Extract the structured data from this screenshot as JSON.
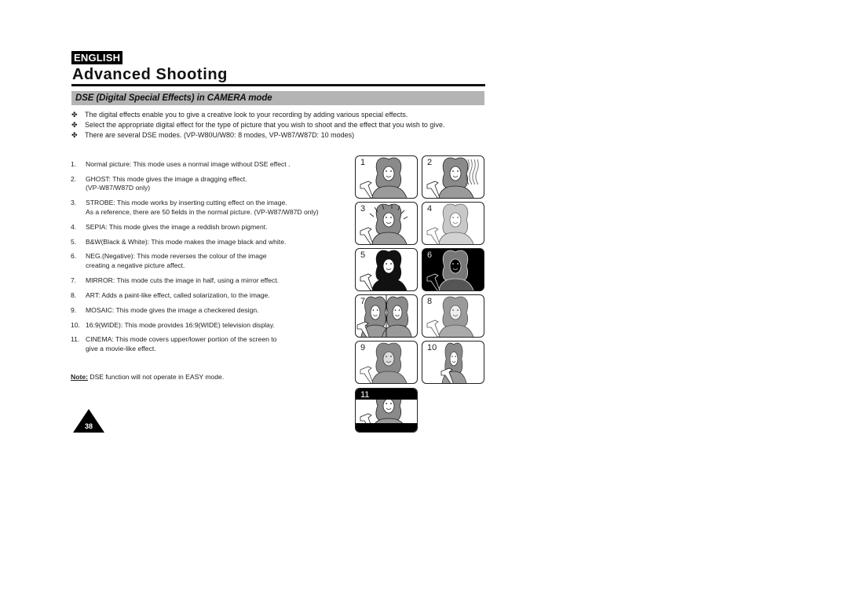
{
  "header": {
    "language": "ENGLISH",
    "title": "Advanced Shooting",
    "section_title": "DSE (Digital Special Effects) in CAMERA mode"
  },
  "intro": {
    "bullet_icon": "four-petal-ornament",
    "items": [
      "The digital effects enable you to give a creative look to your recording by adding various special effects.",
      "Select the appropriate digital effect for the type of picture that you wish to shoot and the effect that you wish to give.",
      "There are several DSE modes. (VP-W80U/W80: 8 modes, VP-W87/W87D: 10 modes)"
    ]
  },
  "modes": [
    {
      "num": "1.",
      "text": "Normal picture:  This mode uses a normal image without DSE effect ."
    },
    {
      "num": "2.",
      "text": "GHOST: This mode gives the image a dragging effect.\n(VP-W87/W87D only)"
    },
    {
      "num": "3.",
      "text": "STROBE: This mode works by inserting cutting effect on the image.\nAs a reference, there are 50 fields in the normal picture. (VP-W87/W87D only)"
    },
    {
      "num": "4.",
      "text": "SEPIA: This mode gives the image a reddish brown pigment."
    },
    {
      "num": "5.",
      "text": "B&W(Black & White): This mode makes the image black and white."
    },
    {
      "num": "6.",
      "text": "NEG.(Negative): This mode reverses the colour of the image\ncreating a negative picture affect."
    },
    {
      "num": "7.",
      "text": "MIRROR: This mode cuts the image in half, using a mirror effect."
    },
    {
      "num": "8.",
      "text": "ART: Adds a paint-like effect, called solarization, to the image."
    },
    {
      "num": "9.",
      "text": "MOSAIC: This mode gives the image a checkered design."
    },
    {
      "num": "10.",
      "text": "16:9(WIDE): This mode provides 16:9(WIDE) television display."
    },
    {
      "num": "11.",
      "text": "CINEMA: This mode covers upper/lower portion of the screen to\ngive a movie-like effect."
    }
  ],
  "note": {
    "label": "Note:",
    "text": " DSE function will not operate in EASY mode."
  },
  "page_number": "38",
  "thumbnails": [
    {
      "label": "1",
      "effect": "normal"
    },
    {
      "label": "2",
      "effect": "ghost"
    },
    {
      "label": "3",
      "effect": "strobe"
    },
    {
      "label": "4",
      "effect": "sepia"
    },
    {
      "label": "5",
      "effect": "black-and-white"
    },
    {
      "label": "6",
      "effect": "negative"
    },
    {
      "label": "7",
      "effect": "mirror"
    },
    {
      "label": "8",
      "effect": "art"
    },
    {
      "label": "9",
      "effect": "mosaic"
    },
    {
      "label": "10",
      "effect": "wide-16-9"
    },
    {
      "label": "11",
      "effect": "cinema"
    }
  ]
}
